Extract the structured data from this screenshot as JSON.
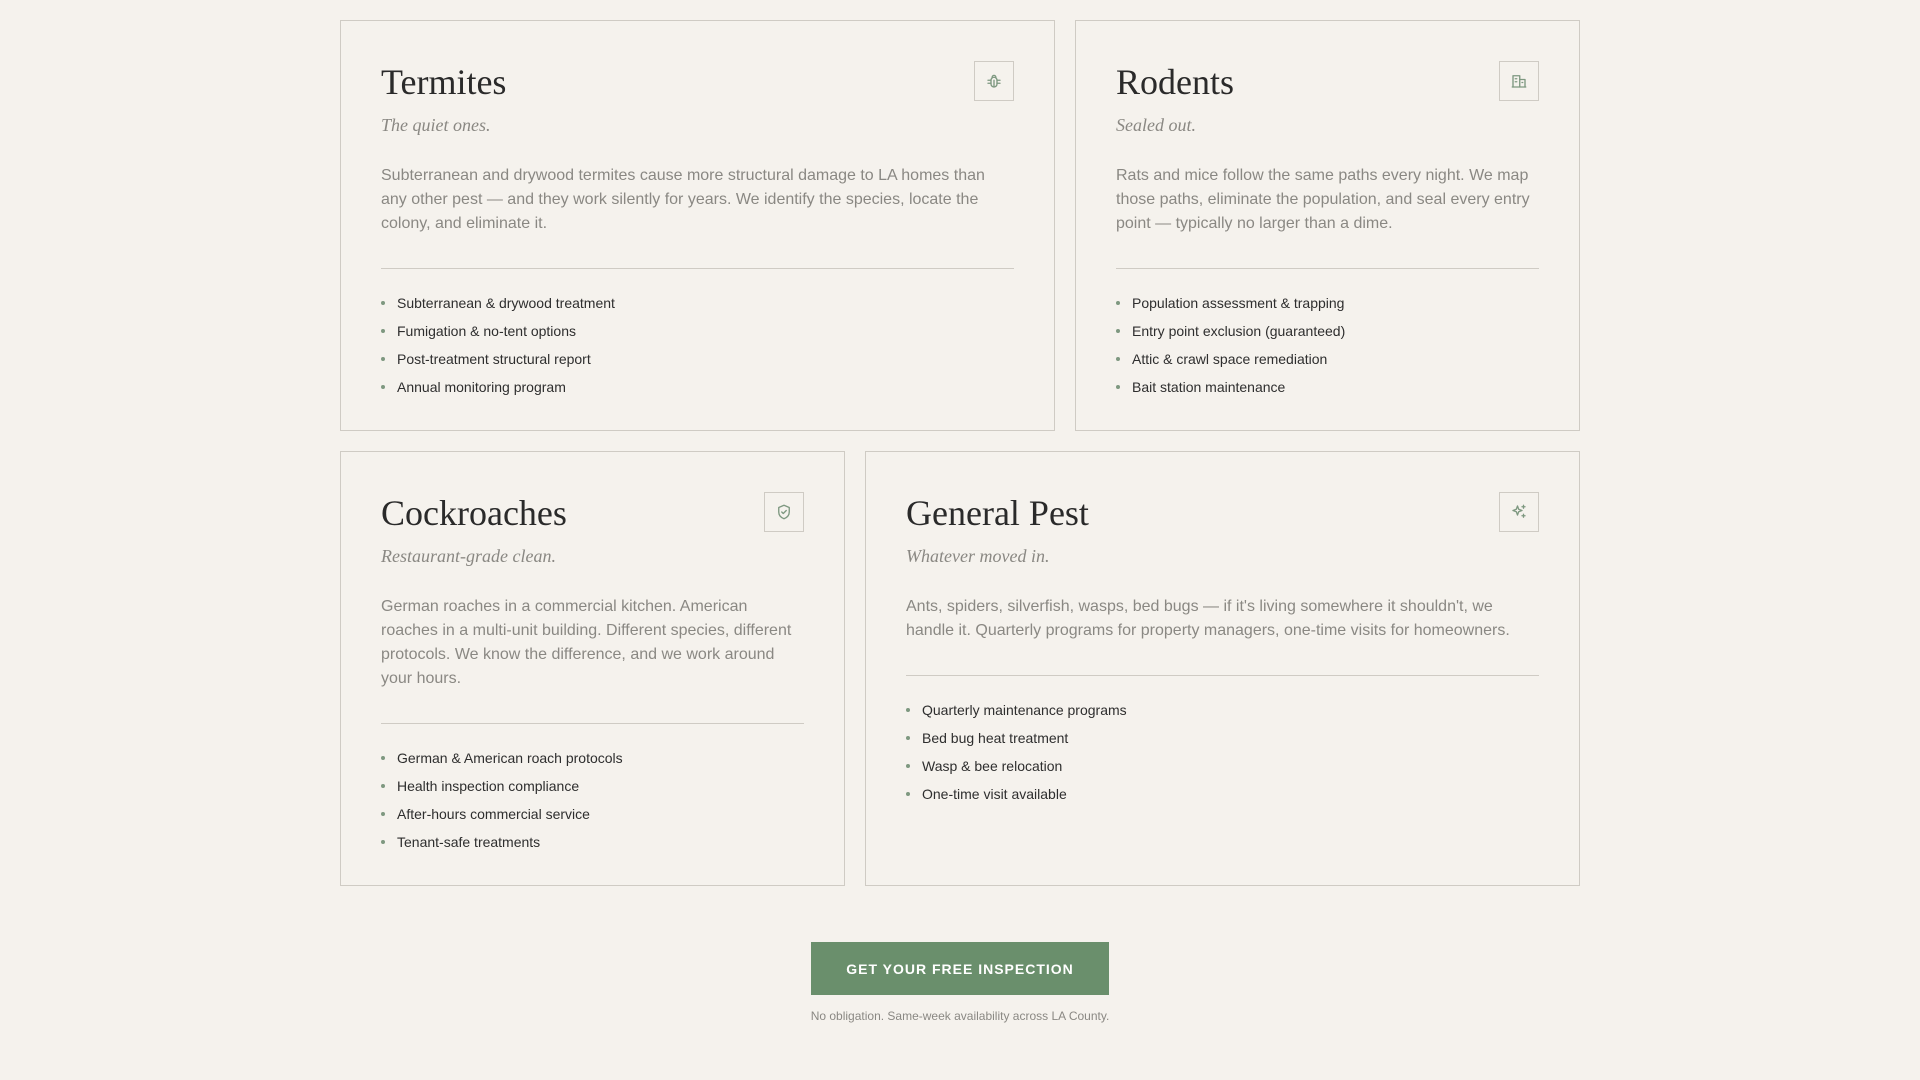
{
  "services": [
    {
      "title": "Termites",
      "tagline": "The quiet ones.",
      "icon": "bug-icon",
      "description": "Subterranean and drywood termites cause more structural damage to LA homes than any other pest — and they work silently for years. We identify the species, locate the colony, and eliminate it.",
      "features": [
        "Subterranean & drywood treatment",
        "Fumigation & no-tent options",
        "Post-treatment structural report",
        "Annual monitoring program"
      ]
    },
    {
      "title": "Rodents",
      "tagline": "Sealed out.",
      "icon": "building-icon",
      "description": "Rats and mice follow the same paths every night. We map those paths, eliminate the population, and seal every entry point — typically no larger than a dime.",
      "features": [
        "Population assessment & trapping",
        "Entry point exclusion (guaranteed)",
        "Attic & crawl space remediation",
        "Bait station maintenance"
      ]
    },
    {
      "title": "Cockroaches",
      "tagline": "Restaurant-grade clean.",
      "icon": "shield-check-icon",
      "description": "German roaches in a commercial kitchen. American roaches in a multi-unit building. Different species, different protocols. We know the difference, and we work around your hours.",
      "features": [
        "German & American roach protocols",
        "Health inspection compliance",
        "After-hours commercial service",
        "Tenant-safe treatments"
      ]
    },
    {
      "title": "General Pest",
      "tagline": "Whatever moved in.",
      "icon": "sparkles-icon",
      "description": "Ants, spiders, silverfish, wasps, bed bugs — if it's living somewhere it shouldn't, we handle it. Quarterly programs for property managers, one-time visits for homeowners.",
      "features": [
        "Quarterly maintenance programs",
        "Bed bug heat treatment",
        "Wasp & bee relocation",
        "One-time visit available"
      ]
    }
  ],
  "cta": {
    "label": "GET YOUR FREE INSPECTION",
    "note": "No obligation. Same-week availability across LA County."
  },
  "colors": {
    "accent": "#6a8f6c",
    "background": "#f5f2ed",
    "border": "#cfcbc4",
    "muted_text": "#8a8883"
  }
}
